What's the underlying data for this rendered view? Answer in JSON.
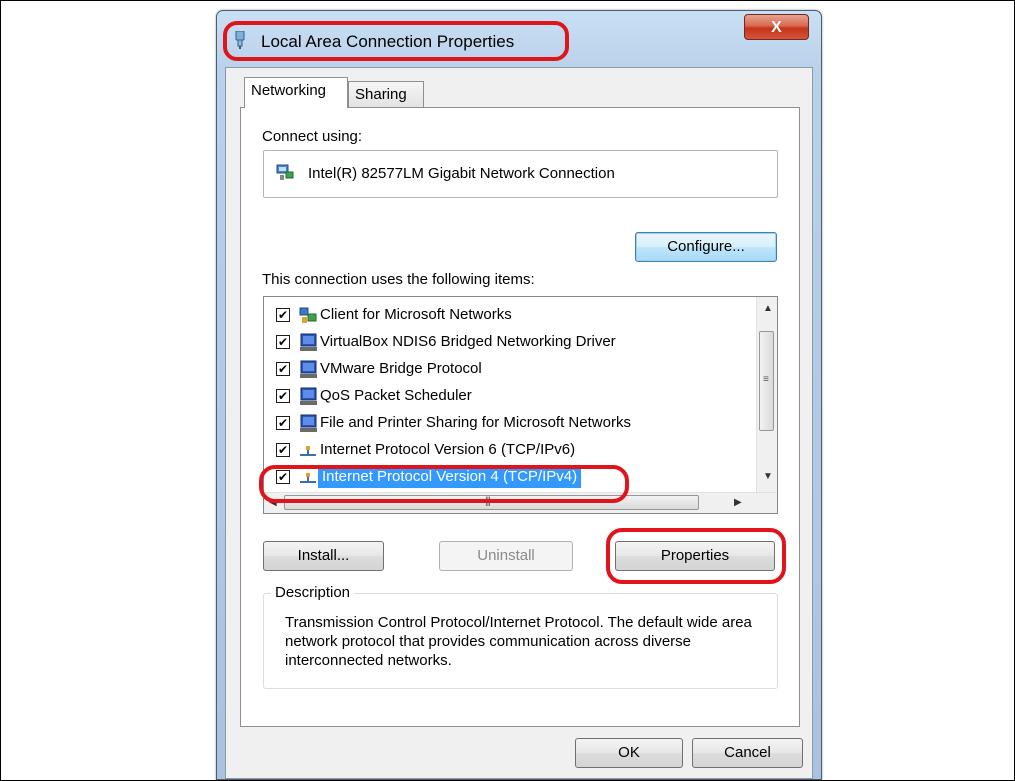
{
  "window": {
    "title": "Local Area Connection Properties",
    "close_glyph": "X"
  },
  "tabs": [
    {
      "label": "Networking",
      "active": true
    },
    {
      "label": "Sharing",
      "active": false
    }
  ],
  "connect_using_label": "Connect using:",
  "adapter": {
    "name": "Intel(R) 82577LM Gigabit Network Connection",
    "icon": "network-adapter-icon"
  },
  "configure_label": "Configure...",
  "items_label": "This connection uses the following items:",
  "items": [
    {
      "label": "Client for Microsoft Networks",
      "checked": true,
      "icon": "client-network-icon"
    },
    {
      "label": "VirtualBox NDIS6 Bridged Networking Driver",
      "checked": true,
      "icon": "monitor-service-icon"
    },
    {
      "label": "VMware Bridge Protocol",
      "checked": true,
      "icon": "monitor-service-icon"
    },
    {
      "label": "QoS Packet Scheduler",
      "checked": true,
      "icon": "monitor-service-icon"
    },
    {
      "label": "File and Printer Sharing for Microsoft Networks",
      "checked": true,
      "icon": "monitor-service-icon"
    },
    {
      "label": "Internet Protocol Version 6 (TCP/IPv6)",
      "checked": true,
      "icon": "protocol-icon"
    },
    {
      "label": "Internet Protocol Version 4 (TCP/IPv4)",
      "checked": true,
      "icon": "protocol-icon",
      "selected": true
    }
  ],
  "buttons": {
    "install": "Install...",
    "uninstall": "Uninstall",
    "properties": "Properties",
    "ok": "OK",
    "cancel": "Cancel"
  },
  "description": {
    "legend": "Description",
    "text": "Transmission Control Protocol/Internet Protocol. The default wide area network protocol that provides communication across diverse interconnected networks."
  },
  "colors": {
    "highlight_ring": "#e0151b",
    "selection": "#3399ff"
  }
}
